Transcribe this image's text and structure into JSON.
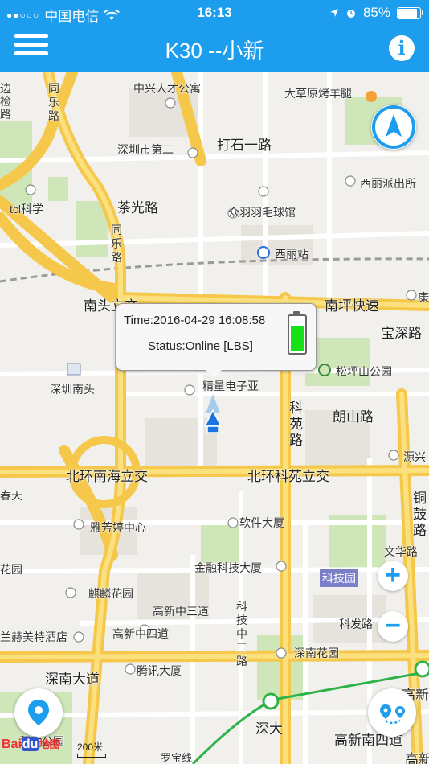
{
  "status_bar": {
    "signal": "●●○○○",
    "carrier": "中国电信",
    "time": "16:13",
    "battery": "85%"
  },
  "nav": {
    "title": "K30 --小新"
  },
  "popup": {
    "time": "Time:2016-04-29 16:08:58",
    "status": "Status:Online [LBS]",
    "battery_level": 0.7
  },
  "map_labels": [
    "边检路",
    "同乐路",
    "中兴人才公寓",
    "大草原烤羊腿",
    "深圳市第二",
    "打石一路",
    "西丽派出所",
    "茶光路",
    "tcl科学",
    "众羽羽毛球馆",
    "同乐路",
    "西丽站",
    "南头立交",
    "康",
    "南坪快速",
    "宝深路",
    "深圳南头",
    "精量电子亚",
    "松坪山公园",
    "科苑路",
    "朗山路",
    "北环南海立交",
    "北环科苑立交",
    "源兴",
    "春天",
    "铜鼓路",
    "雅芳婷中心",
    "软件大厦",
    "文华路",
    "花园",
    "金融科技大厦",
    "科技园",
    "麒麟花园",
    "高新中三道",
    "科技中三路",
    "科发路",
    "兰赫美特酒店",
    "高新中四道",
    "深南花园",
    "深南大道",
    "腾讯大厦",
    "高新",
    "荔香公园",
    "深大",
    "罗宝线",
    "高新南四道",
    "高新"
  ],
  "attribution": {
    "baidu_text": "Bai",
    "du": "du",
    "map": "地图",
    "scale": "200米"
  }
}
